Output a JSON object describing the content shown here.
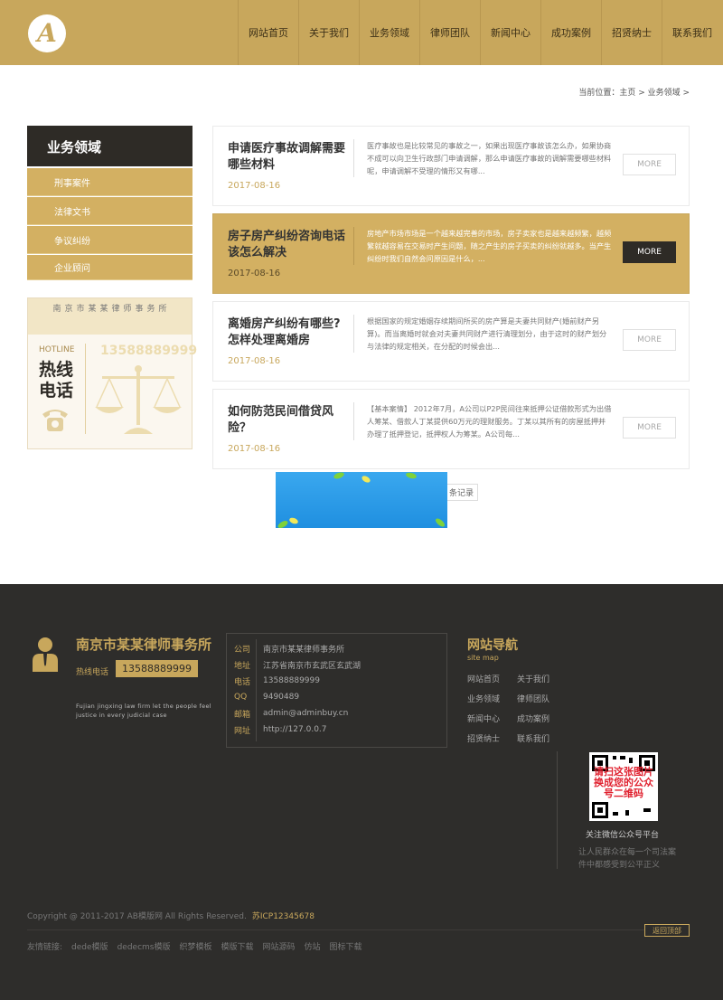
{
  "brand": {
    "logo_letter": "A"
  },
  "nav": [
    "网站首页",
    "关于我们",
    "业务领域",
    "律师团队",
    "新闻中心",
    "成功案例",
    "招贤纳士",
    "联系我们"
  ],
  "breadcrumb": "当前位置：主页 > 业务领域 >",
  "sidebar": {
    "title": "业务领域",
    "items": [
      "刑事案件",
      "法律文书",
      "争议纠纷",
      "企业顾问"
    ]
  },
  "hotline_box": {
    "firm": "南京市某某律师事务所",
    "label": "HOTLINE",
    "big_line1": "热线",
    "big_line2": "电话",
    "number": "13588889999"
  },
  "articles": [
    {
      "title": "申请医疗事故调解需要哪些材料",
      "date": "2017-08-16",
      "desc": "医疗事故也是比较常见的事故之一，如果出现医疗事故该怎么办，如果协商不成可以向卫生行政部门申请调解，那么申请医疗事故的调解需要哪些材料呢，申请调解不受理的情形又有哪...",
      "more": "MORE"
    },
    {
      "title": "房子房产纠纷咨询电话该怎么解决",
      "date": "2017-08-16",
      "desc": "房地产市场市场是一个越来越完善的市场，房子卖家也是越来越频繁，越频繁就越容易在交易时产生问题，随之产生的房子买卖的纠纷就越多。当产生纠纷时我们自然会问原因是什么，...",
      "more": "MORE"
    },
    {
      "title": "离婚房产纠纷有哪些?怎样处理离婚房",
      "date": "2017-08-16",
      "desc": "根据国家的规定婚姻存续期间所买的房产算是夫妻共同财产(婚前财产另算)。而当离婚时就会对夫妻共同财产进行清理划分，由于这时的财产划分与法律的规定相关，在分配的时候会出...",
      "more": "MORE"
    },
    {
      "title": "如何防范民间借贷风险？",
      "date": "2017-08-16",
      "desc": "【基本案情】 2012年7月，A公司以P2P民间往来抵押公证借款形式为出借人筹某、借款人丁某提供60万元的理财服务。丁某以其所有的房屋抵押并办理了抵押登记，抵押权人为筹某。A公司每...",
      "more": "MORE"
    }
  ],
  "pager": {
    "label": "条记录"
  },
  "footer": {
    "firm": "南京市某某律师事务所",
    "hotline_label": "热线电话",
    "hotline_number": "13588889999",
    "slogan": "Fujian jingxing law firm let the people feel justice in every judicial case",
    "info": [
      {
        "k": "公司",
        "v": "南京市某某律师事务所"
      },
      {
        "k": "地址",
        "v": "江苏省南京市玄武区玄武湖"
      },
      {
        "k": "电话",
        "v": "13588889999"
      },
      {
        "k": "QQ",
        "v": "9490489"
      },
      {
        "k": "邮箱",
        "v": "admin@adminbuy.cn"
      },
      {
        "k": "网址",
        "v": "http://127.0.0.7"
      }
    ],
    "nav_title": "网站导航",
    "nav_sub": "site map",
    "links": [
      "网站首页",
      "关于我们",
      "业务领域",
      "律师团队",
      "新闻中心",
      "成功案例",
      "招贤纳士",
      "联系我们"
    ],
    "qr_text": "请扫这张图片换成您的公众号二维码",
    "qr_caption": "关注微信公众号平台",
    "qr_desc": "让人民群众在每一个司法案件中都感受到公平正义",
    "copyright": "Copyright @ 2011-2017 AB模版网 All Rights Reserved.",
    "icp": "苏ICP12345678",
    "back_top": "返回顶部",
    "friend_label": "友情链接:",
    "friend_links": [
      "dede模版",
      "dedecms模版",
      "织梦模板",
      "模版下载",
      "网站源码",
      "仿站",
      "图标下载"
    ]
  },
  "colors": {
    "gold": "#c8a75c",
    "dark": "#2e2b26",
    "footer_bg": "#2e2d2b"
  }
}
